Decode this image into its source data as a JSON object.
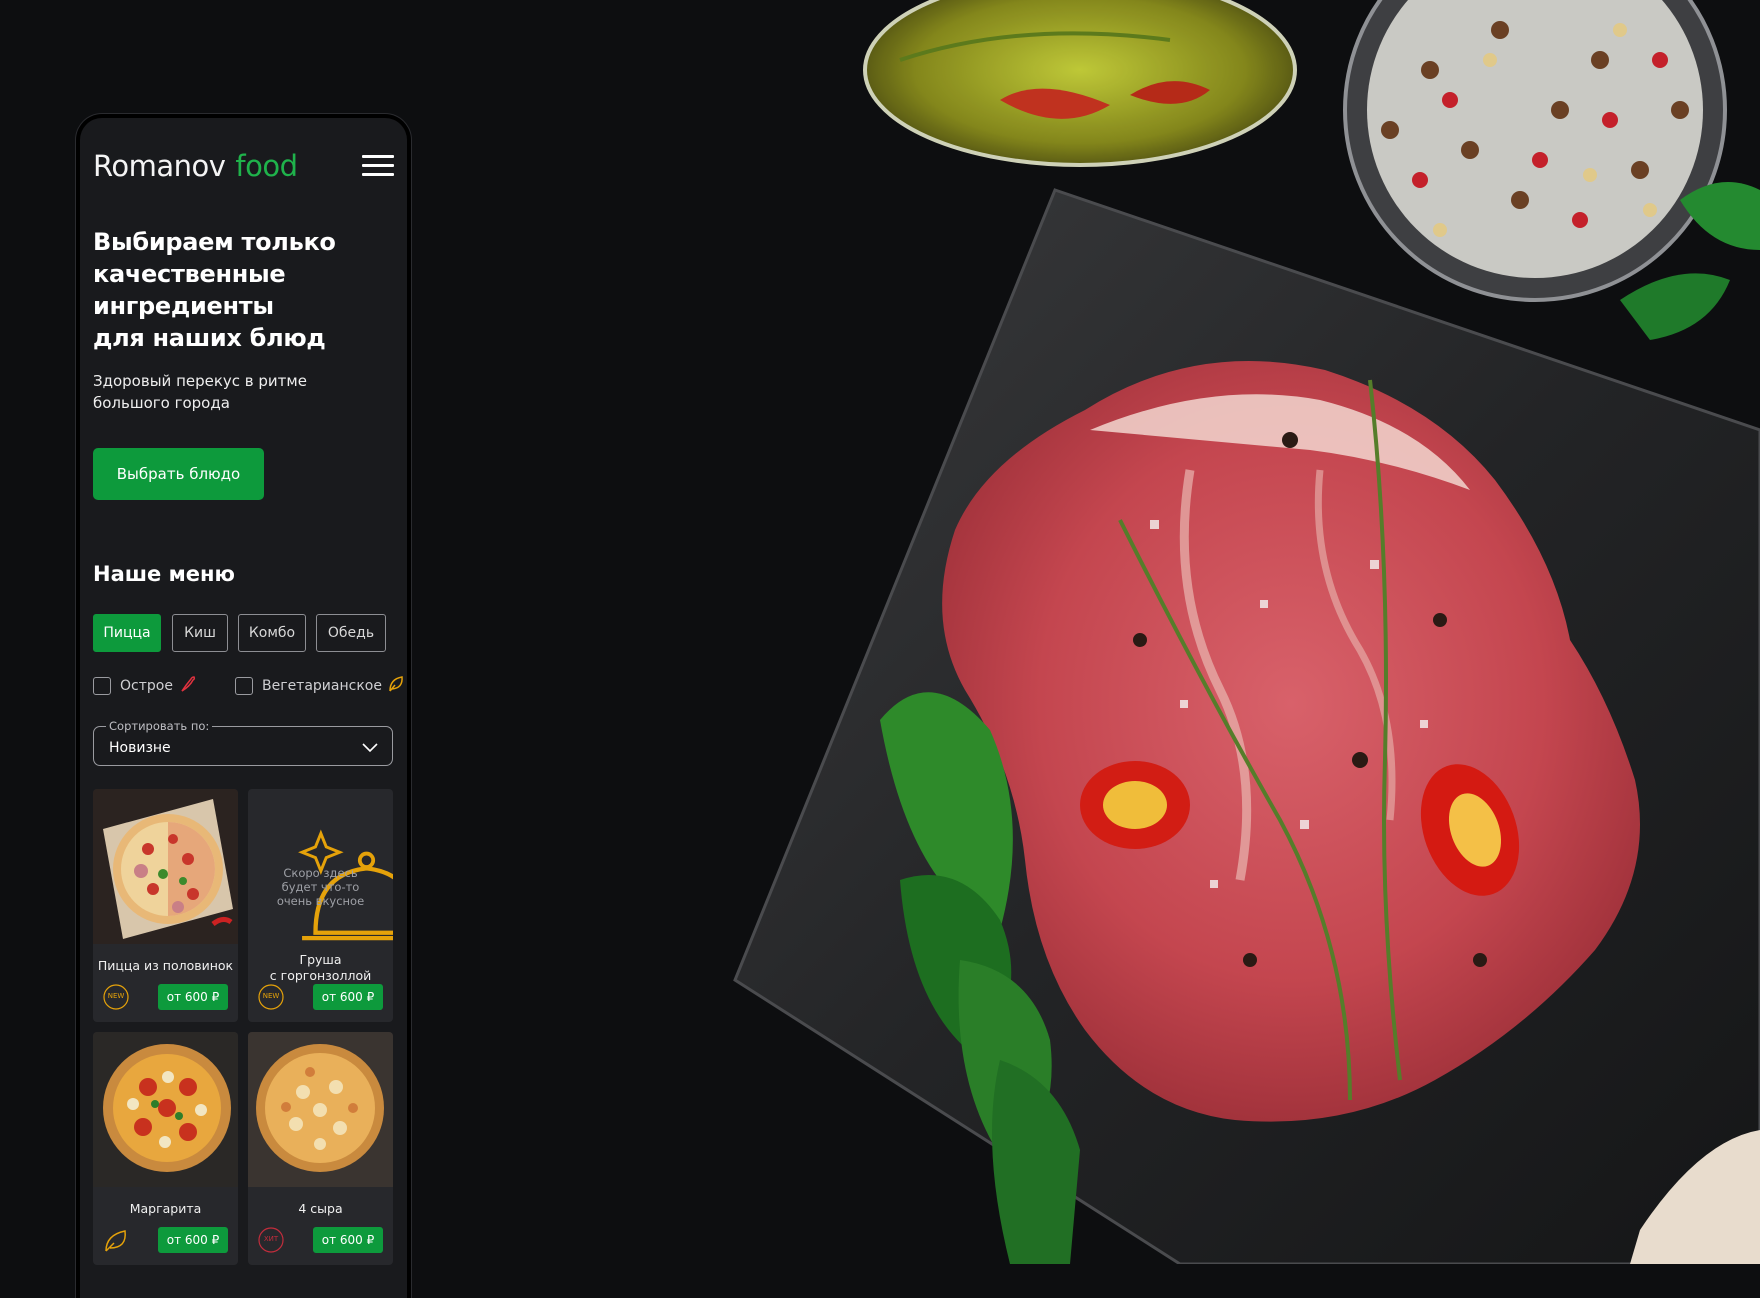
{
  "brand": {
    "part1": "Romanov",
    "part2": "food",
    "accent_color": "#1fb24b"
  },
  "header": {
    "menu_icon": "hamburger-menu-icon"
  },
  "hero": {
    "title": "Выбираем только\nкачественные\nингредиенты\nдля наших блюд",
    "subtitle": "Здоровый перекус в ритме\nбольшого города",
    "cta_label": "Выбрать блюдо"
  },
  "menu": {
    "title": "Наше меню",
    "tabs": [
      {
        "label": "Пицца",
        "active": true
      },
      {
        "label": "Киш",
        "active": false
      },
      {
        "label": "Комбо",
        "active": false
      },
      {
        "label": "Обедь",
        "active": false
      }
    ],
    "filters": [
      {
        "label": "Острое",
        "checked": false,
        "icon": "chili-pepper-icon"
      },
      {
        "label": "Вегетарианское",
        "checked": false,
        "icon": "leaf-icon"
      }
    ],
    "sort": {
      "legend": "Сортировать по:",
      "value": "Новизне"
    }
  },
  "products": [
    {
      "name": "Пицца из половинок",
      "price": "от 600 ₽",
      "badge": "NEW",
      "badge_icon": "new-badge-icon",
      "image": "half-pizza-photo"
    },
    {
      "name": "Груша\nс горгонзоллой",
      "price": "от 600 ₽",
      "badge": "NEW",
      "badge_icon": "new-badge-icon",
      "placeholder_text": "Скоро здесь\nбудет что-то\nочень вкусное",
      "image": "cloche-icon"
    },
    {
      "name": "Маргарита",
      "price": "от 600 ₽",
      "badge": "",
      "badge_icon": "leaf-icon",
      "image": "margherita-photo"
    },
    {
      "name": "4 сыра",
      "price": "от 600 ₽",
      "badge": "ХИТ",
      "badge_icon": "hit-badge-icon",
      "image": "four-cheese-photo"
    }
  ],
  "colors": {
    "primary_green": "#0d9a3c",
    "background": "#0d0e10",
    "panel": "#191a1d",
    "card": "#27282c",
    "badge_orange": "#e5a20a",
    "badge_red": "#c22d3c"
  }
}
